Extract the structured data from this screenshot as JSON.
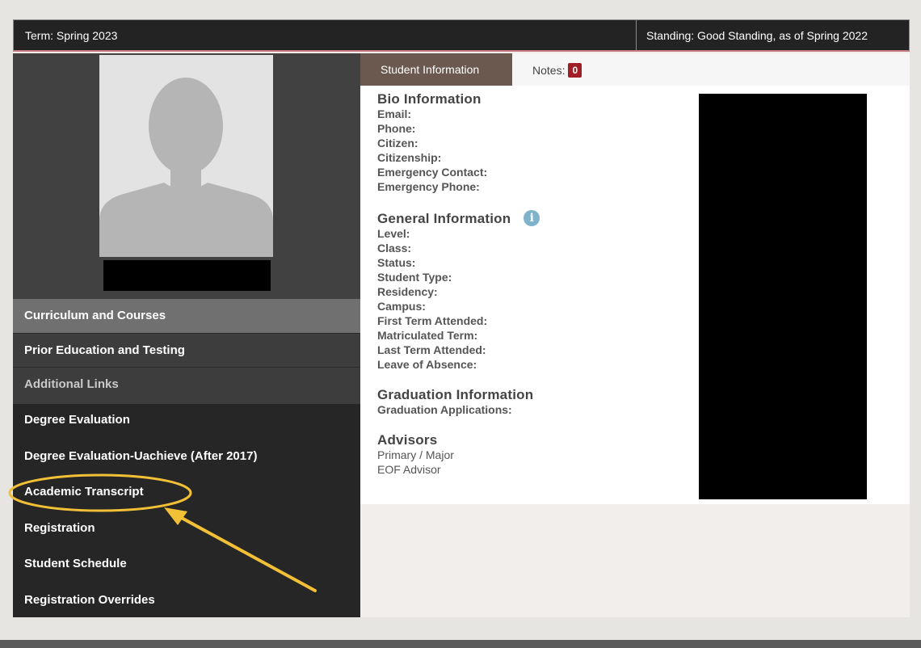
{
  "topbar": {
    "term": "Term: Spring 2023",
    "standing": "Standing: Good Standing, as of Spring 2022"
  },
  "sidebar": {
    "sections": [
      {
        "label": "Curriculum and Courses"
      },
      {
        "label": "Prior Education and Testing"
      },
      {
        "label": "Additional Links"
      }
    ],
    "links": [
      {
        "label": "Degree Evaluation"
      },
      {
        "label": "Degree Evaluation-Uachieve (After 2017)"
      },
      {
        "label": "Academic Transcript"
      },
      {
        "label": "Registration"
      },
      {
        "label": "Student Schedule"
      },
      {
        "label": "Registration Overrides"
      }
    ]
  },
  "tabs": {
    "active": "Student Information",
    "notes_label": "Notes:",
    "notes_count": "0"
  },
  "bio": {
    "heading": "Bio Information",
    "fields": [
      "Email:",
      "Phone:",
      "Citizen:",
      "Citizenship:",
      "Emergency Contact:",
      "Emergency Phone:"
    ]
  },
  "general": {
    "heading": "General Information",
    "info_icon": "i",
    "fields": [
      "Level:",
      "Class:",
      "Status:",
      "Student Type:",
      "Residency:",
      "Campus:",
      "First Term Attended:",
      "Matriculated Term:",
      "Last Term Attended:",
      "Leave of Absence:"
    ]
  },
  "graduation": {
    "heading": "Graduation Information",
    "fields": [
      "Graduation Applications:"
    ]
  },
  "advisors": {
    "heading": "Advisors",
    "fields": [
      "Primary / Major",
      "EOF Advisor"
    ]
  },
  "colors": {
    "accent_highlight": "#f2c037",
    "tab_active": "#6b5950",
    "badge": "#a01e25"
  }
}
